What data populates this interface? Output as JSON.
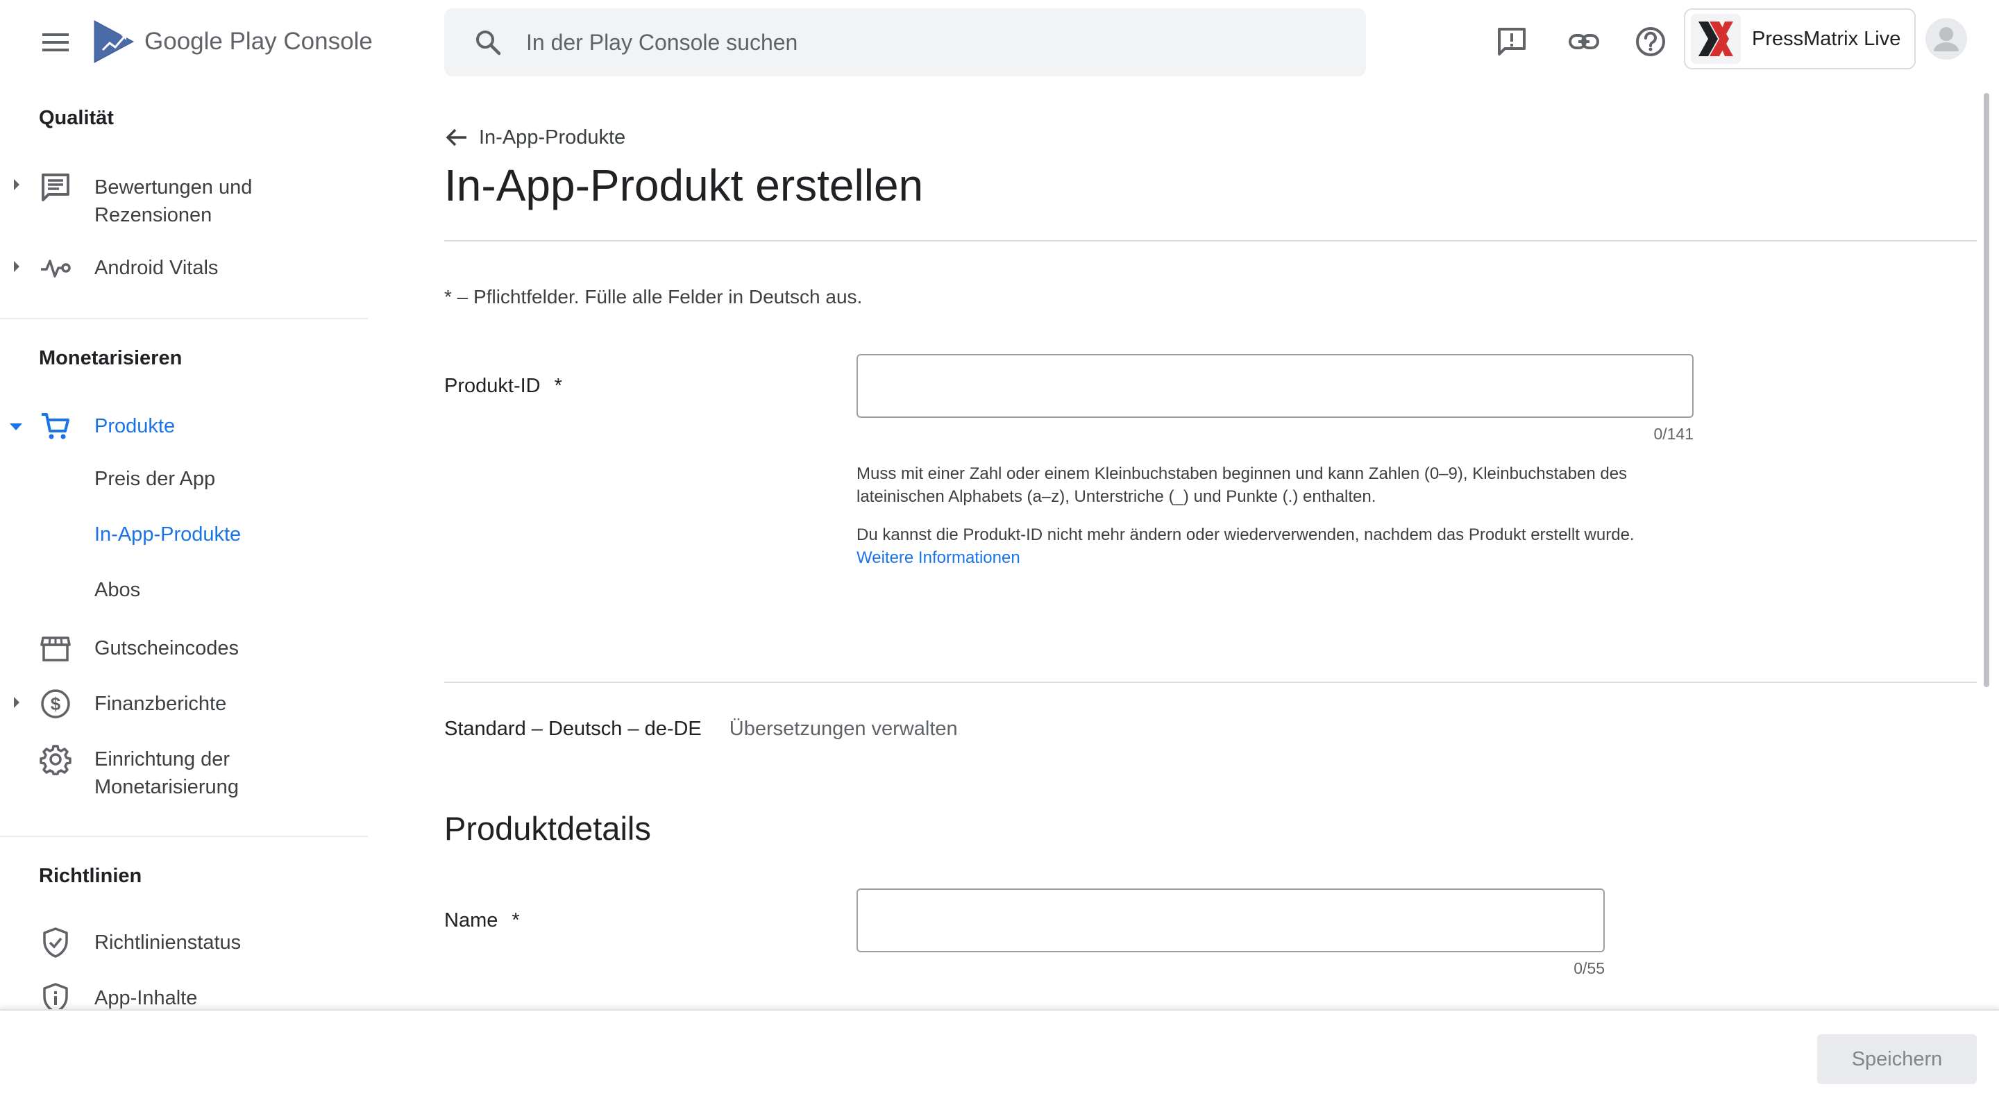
{
  "header": {
    "logo_brand": "Google Play",
    "logo_product": "Console",
    "search_placeholder": "In der Play Console suchen",
    "account_name": "PressMatrix Live",
    "icons": [
      "menu-icon",
      "search-icon",
      "feedback-icon",
      "link-icon",
      "help-icon",
      "account-avatar-icon"
    ],
    "colors": {
      "logo_blue": "#4a6aa8",
      "app_logo_red": "#d32f2f",
      "app_logo_dark": "#202124"
    }
  },
  "sidebar": {
    "sections": [
      {
        "title": "Qualität",
        "items": [
          {
            "label": "Bewertungen und\nRezensionen",
            "icon": "reviews-icon",
            "expandable": true
          },
          {
            "label": "Android Vitals",
            "icon": "vitals-icon",
            "expandable": true
          }
        ]
      },
      {
        "title": "Monetarisieren",
        "items": [
          {
            "label": "Produkte",
            "icon": "cart-icon",
            "expandable": true,
            "expanded": true,
            "active": true
          },
          {
            "label": "Preis der App",
            "sub": true
          },
          {
            "label": "In-App-Produkte",
            "sub": true,
            "active": true
          },
          {
            "label": "Abos",
            "sub": true
          },
          {
            "label": "Gutscheincodes",
            "icon": "store-icon"
          },
          {
            "label": "Finanzberichte",
            "icon": "dollar-icon",
            "expandable": true
          },
          {
            "label": "Einrichtung der\nMonetarisierung",
            "icon": "gear-icon"
          }
        ]
      },
      {
        "title": "Richtlinien",
        "items": [
          {
            "label": "Richtlinienstatus",
            "icon": "shield-check-icon"
          },
          {
            "label": "App-Inhalte",
            "icon": "shield-info-icon"
          }
        ]
      }
    ],
    "active_color": "#1a73e8"
  },
  "main": {
    "breadcrumb": "In-App-Produkte",
    "title": "In-App-Produkt erstellen",
    "required_note": "* – Pflichtfelder. Fülle alle Felder in Deutsch aus.",
    "product_id": {
      "label": "Produkt-ID",
      "required_mark": "*",
      "value": "",
      "counter": "0/141",
      "help_1": "Muss mit einer Zahl oder einem Kleinbuchstaben beginnen und kann Zahlen (0–9), Kleinbuchstaben des lateinischen Alphabets (a–z), Unterstriche (_) und Punkte (.) enthalten.",
      "help_2": "Du kannst die Produkt-ID nicht mehr ändern oder wiederverwenden, nachdem das Produkt erstellt wurde.",
      "help_link": "Weitere Informationen"
    },
    "language": {
      "default": "Standard – Deutsch – de-DE",
      "manage": "Übersetzungen verwalten"
    },
    "details_heading": "Produktdetails",
    "name_field": {
      "label": "Name",
      "required_mark": "*",
      "value": "",
      "counter": "0/55"
    }
  },
  "footer": {
    "save_label": "Speichern",
    "save_enabled": false
  }
}
